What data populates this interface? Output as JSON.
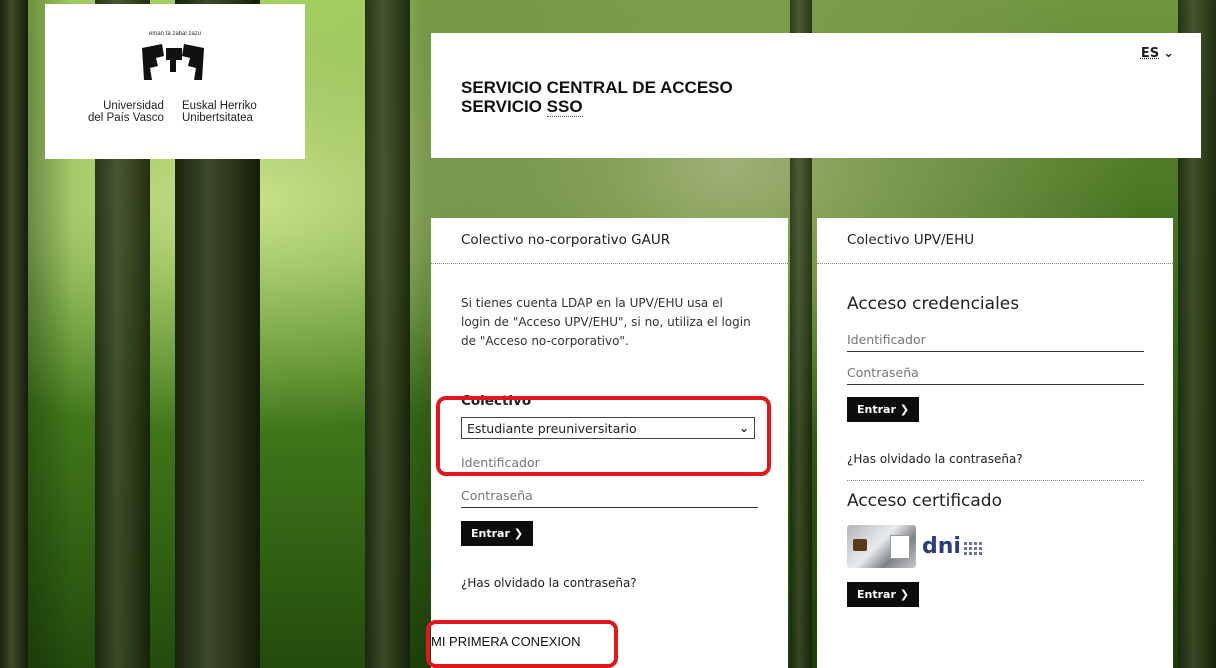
{
  "logo": {
    "tagline": "eman ta zabal zazu",
    "name_es_line1": "Universidad",
    "name_es_line2": "del País Vasco",
    "name_eu_line1": "Euskal Herriko",
    "name_eu_line2": "Unibertsitatea"
  },
  "header": {
    "language": "ES",
    "title_line1": "SERVICIO CENTRAL DE ACCESO",
    "title_line2_prefix": "SERVICIO ",
    "title_line2_abbr": "SSO"
  },
  "gaur": {
    "heading": "Colectivo no-corporativo GAUR",
    "intro": "Si tienes cuenta LDAP en la UPV/EHU usa el login de \"Acceso UPV/EHU\", si no, utiliza el login de \"Acceso no-corporativo\".",
    "colectivo_label": "Colectivo",
    "colectivo_selected": "Estudiante preuniversitario",
    "identificador_placeholder": "Identificador",
    "contrasena_placeholder": "Contraseña",
    "submit_label": "Entrar",
    "forgot_label": "¿Has olvidado la contraseña?",
    "first_connection_label": "MI PRIMERA CONEXION"
  },
  "upv": {
    "heading": "Colectivo UPV/EHU",
    "credentials_title": "Acceso credenciales",
    "identificador_placeholder": "Identificador",
    "contrasena_placeholder": "Contraseña",
    "submit_label": "Entrar",
    "forgot_label": "¿Has olvidado la contraseña?",
    "certificate_title": "Acceso certificado",
    "dni_text": "dni",
    "certificate_submit_label": "Entrar"
  },
  "icons": {
    "arrow": "chevron-right-icon",
    "language_toggle": "chevron-down-icon",
    "select_toggle": "chevron-down-icon"
  },
  "colors": {
    "highlight": "#e0181e",
    "button": "#0c0c0c"
  }
}
